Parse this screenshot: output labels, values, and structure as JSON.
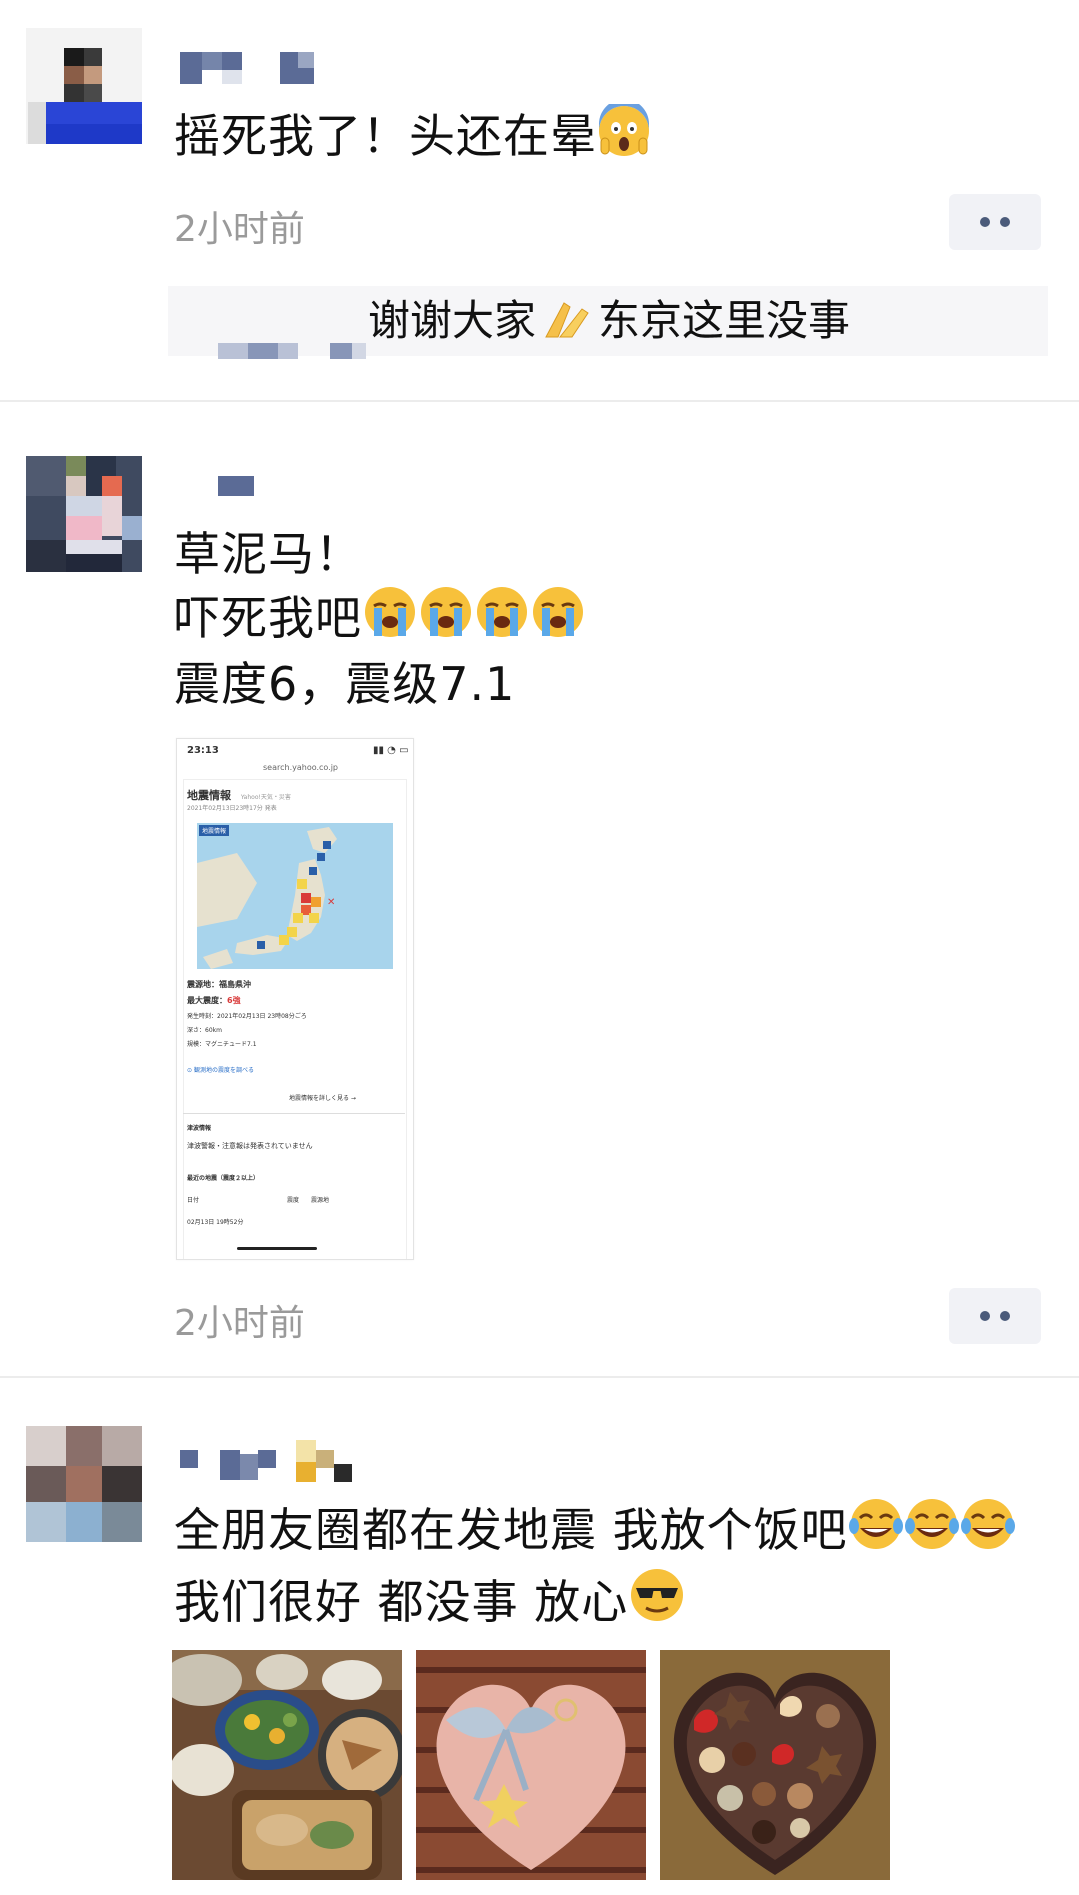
{
  "posts": [
    {
      "text_lines": [
        "摇死我了！头还在晕"
      ],
      "time": "2小时前",
      "comment": "谢谢大家",
      "comment_tail": "东京这里没事"
    },
    {
      "text_lines": [
        "草泥马！",
        "吓死我吧",
        "震度6，震级7.1"
      ],
      "time": "2小时前",
      "screenshot": {
        "status_time": "23:13",
        "url": "search.yahoo.co.jp",
        "title": "地震情報",
        "title_sub": "Yahoo!天気・災害",
        "issued": "2021年02月13日23時17分 発表",
        "map_badge": "地震情報",
        "epicenter_label": "震源地：",
        "epicenter": "福島県沖",
        "max_intensity_label": "最大震度：",
        "max_intensity": "6強",
        "occurred": "発生時刻：2021年02月13日 23時08分ごろ",
        "depth": "深さ：60km",
        "magnitude": "規模：マグニチュード7.1",
        "link1": "観測地の震度を調べる",
        "link2": "地震情報を詳しく見る →",
        "tsunami_title": "津波情報",
        "tsunami_text": "津波警報・注意報は発表されていません",
        "recent_title": "最近の地震（震度２以上）",
        "col_date": "日付",
        "col_intensity": "震度",
        "col_place": "震源地",
        "row1": "02月13日 19時52分"
      }
    },
    {
      "text_lines": [
        "全朋友圈都在发地震 我放个饭吧",
        "我们很好 都没事 放心"
      ]
    }
  ],
  "colors": {
    "time_gray": "#9a9a9a",
    "divider": "#ececec",
    "more_bg": "#f1f2f6",
    "more_dots": "#4b5b7a",
    "name_blue": "#5b6b96"
  },
  "icons": [
    "more-dots-icon",
    "scream-emoji",
    "crying-emoji",
    "laughing-emoji",
    "sunglasses-emoji",
    "praying-hands-emoji"
  ]
}
